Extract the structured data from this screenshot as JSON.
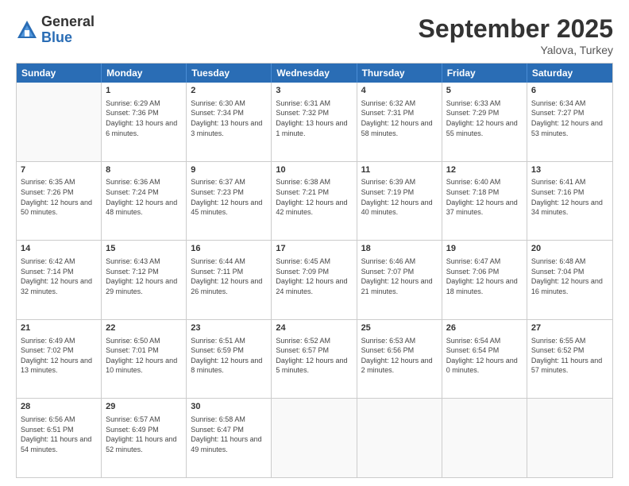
{
  "logo": {
    "general": "General",
    "blue": "Blue"
  },
  "title": {
    "month": "September 2025",
    "location": "Yalova, Turkey"
  },
  "header": {
    "days": [
      "Sunday",
      "Monday",
      "Tuesday",
      "Wednesday",
      "Thursday",
      "Friday",
      "Saturday"
    ]
  },
  "weeks": [
    [
      {
        "day": "",
        "sunrise": "",
        "sunset": "",
        "daylight": ""
      },
      {
        "day": "1",
        "sunrise": "Sunrise: 6:29 AM",
        "sunset": "Sunset: 7:36 PM",
        "daylight": "Daylight: 13 hours and 6 minutes."
      },
      {
        "day": "2",
        "sunrise": "Sunrise: 6:30 AM",
        "sunset": "Sunset: 7:34 PM",
        "daylight": "Daylight: 13 hours and 3 minutes."
      },
      {
        "day": "3",
        "sunrise": "Sunrise: 6:31 AM",
        "sunset": "Sunset: 7:32 PM",
        "daylight": "Daylight: 13 hours and 1 minute."
      },
      {
        "day": "4",
        "sunrise": "Sunrise: 6:32 AM",
        "sunset": "Sunset: 7:31 PM",
        "daylight": "Daylight: 12 hours and 58 minutes."
      },
      {
        "day": "5",
        "sunrise": "Sunrise: 6:33 AM",
        "sunset": "Sunset: 7:29 PM",
        "daylight": "Daylight: 12 hours and 55 minutes."
      },
      {
        "day": "6",
        "sunrise": "Sunrise: 6:34 AM",
        "sunset": "Sunset: 7:27 PM",
        "daylight": "Daylight: 12 hours and 53 minutes."
      }
    ],
    [
      {
        "day": "7",
        "sunrise": "Sunrise: 6:35 AM",
        "sunset": "Sunset: 7:26 PM",
        "daylight": "Daylight: 12 hours and 50 minutes."
      },
      {
        "day": "8",
        "sunrise": "Sunrise: 6:36 AM",
        "sunset": "Sunset: 7:24 PM",
        "daylight": "Daylight: 12 hours and 48 minutes."
      },
      {
        "day": "9",
        "sunrise": "Sunrise: 6:37 AM",
        "sunset": "Sunset: 7:23 PM",
        "daylight": "Daylight: 12 hours and 45 minutes."
      },
      {
        "day": "10",
        "sunrise": "Sunrise: 6:38 AM",
        "sunset": "Sunset: 7:21 PM",
        "daylight": "Daylight: 12 hours and 42 minutes."
      },
      {
        "day": "11",
        "sunrise": "Sunrise: 6:39 AM",
        "sunset": "Sunset: 7:19 PM",
        "daylight": "Daylight: 12 hours and 40 minutes."
      },
      {
        "day": "12",
        "sunrise": "Sunrise: 6:40 AM",
        "sunset": "Sunset: 7:18 PM",
        "daylight": "Daylight: 12 hours and 37 minutes."
      },
      {
        "day": "13",
        "sunrise": "Sunrise: 6:41 AM",
        "sunset": "Sunset: 7:16 PM",
        "daylight": "Daylight: 12 hours and 34 minutes."
      }
    ],
    [
      {
        "day": "14",
        "sunrise": "Sunrise: 6:42 AM",
        "sunset": "Sunset: 7:14 PM",
        "daylight": "Daylight: 12 hours and 32 minutes."
      },
      {
        "day": "15",
        "sunrise": "Sunrise: 6:43 AM",
        "sunset": "Sunset: 7:12 PM",
        "daylight": "Daylight: 12 hours and 29 minutes."
      },
      {
        "day": "16",
        "sunrise": "Sunrise: 6:44 AM",
        "sunset": "Sunset: 7:11 PM",
        "daylight": "Daylight: 12 hours and 26 minutes."
      },
      {
        "day": "17",
        "sunrise": "Sunrise: 6:45 AM",
        "sunset": "Sunset: 7:09 PM",
        "daylight": "Daylight: 12 hours and 24 minutes."
      },
      {
        "day": "18",
        "sunrise": "Sunrise: 6:46 AM",
        "sunset": "Sunset: 7:07 PM",
        "daylight": "Daylight: 12 hours and 21 minutes."
      },
      {
        "day": "19",
        "sunrise": "Sunrise: 6:47 AM",
        "sunset": "Sunset: 7:06 PM",
        "daylight": "Daylight: 12 hours and 18 minutes."
      },
      {
        "day": "20",
        "sunrise": "Sunrise: 6:48 AM",
        "sunset": "Sunset: 7:04 PM",
        "daylight": "Daylight: 12 hours and 16 minutes."
      }
    ],
    [
      {
        "day": "21",
        "sunrise": "Sunrise: 6:49 AM",
        "sunset": "Sunset: 7:02 PM",
        "daylight": "Daylight: 12 hours and 13 minutes."
      },
      {
        "day": "22",
        "sunrise": "Sunrise: 6:50 AM",
        "sunset": "Sunset: 7:01 PM",
        "daylight": "Daylight: 12 hours and 10 minutes."
      },
      {
        "day": "23",
        "sunrise": "Sunrise: 6:51 AM",
        "sunset": "Sunset: 6:59 PM",
        "daylight": "Daylight: 12 hours and 8 minutes."
      },
      {
        "day": "24",
        "sunrise": "Sunrise: 6:52 AM",
        "sunset": "Sunset: 6:57 PM",
        "daylight": "Daylight: 12 hours and 5 minutes."
      },
      {
        "day": "25",
        "sunrise": "Sunrise: 6:53 AM",
        "sunset": "Sunset: 6:56 PM",
        "daylight": "Daylight: 12 hours and 2 minutes."
      },
      {
        "day": "26",
        "sunrise": "Sunrise: 6:54 AM",
        "sunset": "Sunset: 6:54 PM",
        "daylight": "Daylight: 12 hours and 0 minutes."
      },
      {
        "day": "27",
        "sunrise": "Sunrise: 6:55 AM",
        "sunset": "Sunset: 6:52 PM",
        "daylight": "Daylight: 11 hours and 57 minutes."
      }
    ],
    [
      {
        "day": "28",
        "sunrise": "Sunrise: 6:56 AM",
        "sunset": "Sunset: 6:51 PM",
        "daylight": "Daylight: 11 hours and 54 minutes."
      },
      {
        "day": "29",
        "sunrise": "Sunrise: 6:57 AM",
        "sunset": "Sunset: 6:49 PM",
        "daylight": "Daylight: 11 hours and 52 minutes."
      },
      {
        "day": "30",
        "sunrise": "Sunrise: 6:58 AM",
        "sunset": "Sunset: 6:47 PM",
        "daylight": "Daylight: 11 hours and 49 minutes."
      },
      {
        "day": "",
        "sunrise": "",
        "sunset": "",
        "daylight": ""
      },
      {
        "day": "",
        "sunrise": "",
        "sunset": "",
        "daylight": ""
      },
      {
        "day": "",
        "sunrise": "",
        "sunset": "",
        "daylight": ""
      },
      {
        "day": "",
        "sunrise": "",
        "sunset": "",
        "daylight": ""
      }
    ]
  ]
}
